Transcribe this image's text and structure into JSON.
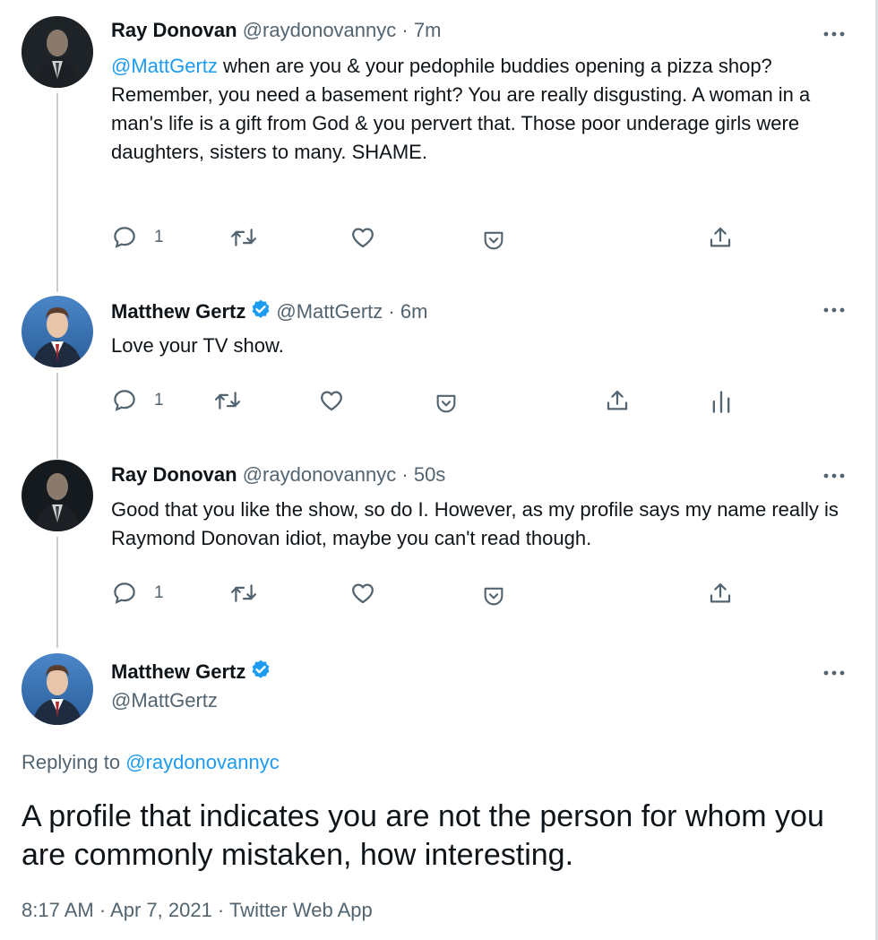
{
  "tweets": [
    {
      "name": "Ray Donovan",
      "handle": "@raydonovannyc",
      "time": "7m",
      "mention": "@MattGertz",
      "text": " when are you & your pedophile buddies opening a pizza shop? Remember, you need a basement right? You are really disgusting. A woman in a man's life is a gift from God & you pervert that. Those poor underage girls were daughters, sisters to many. SHAME.",
      "reply_count": "1"
    },
    {
      "name": "Matthew Gertz",
      "verified": true,
      "handle": "@MattGertz",
      "time": "6m",
      "text": "Love your TV show.",
      "reply_count": "1"
    },
    {
      "name": "Ray Donovan",
      "handle": "@raydonovannyc",
      "time": "50s",
      "text": "Good that you like the show, so do I. However, as my profile says my name really is Raymond Donovan idiot, maybe you can't read though.",
      "reply_count": "1"
    }
  ],
  "main_tweet": {
    "name": "Matthew Gertz",
    "verified": true,
    "handle": "@MattGertz",
    "replying_prefix": "Replying to ",
    "replying_to": "@raydonovannyc",
    "text": "A profile that indicates you are not the person for whom you are commonly mistaken, how interesting.",
    "timestamp": "8:17 AM · Apr 7, 2021 · Twitter Web App"
  },
  "separator": " · ",
  "icons": {
    "reply": "reply-icon",
    "retweet": "retweet-icon",
    "like": "heart-icon",
    "tip": "tip-jar-icon",
    "share": "share-icon",
    "analytics": "analytics-icon",
    "more": "more-options-icon",
    "verified": "verified-badge-icon"
  },
  "colors": {
    "accent": "#1d9bf0",
    "text": "#0f1419",
    "secondary": "#536471",
    "thread_line": "#c4cfd6"
  }
}
